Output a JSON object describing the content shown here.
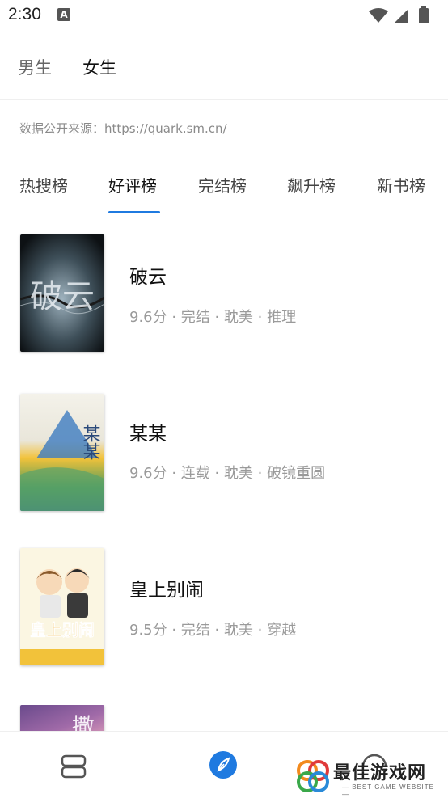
{
  "status_bar": {
    "time": "2:30",
    "notification_letter": "A"
  },
  "gender_tabs": [
    {
      "label": "男生",
      "active": false
    },
    {
      "label": "女生",
      "active": true
    }
  ],
  "source": {
    "text": "数据公开来源：https://quark.sm.cn/"
  },
  "ranking_tabs": [
    {
      "label": "热搜榜",
      "active": false
    },
    {
      "label": "好评榜",
      "active": true
    },
    {
      "label": "完结榜",
      "active": false
    },
    {
      "label": "飙升榜",
      "active": false
    },
    {
      "label": "新书榜",
      "active": false
    }
  ],
  "books": [
    {
      "title": "破云",
      "meta": "9.6分 · 完结 · 耽美 · 推理",
      "cover_text": "破云"
    },
    {
      "title": "某某",
      "meta": "9.6分 · 连载 · 耽美 · 破镜重圆",
      "cover_text": "某某"
    },
    {
      "title": "皇上别闹",
      "meta": "9.5分 · 完结 · 耽美 · 穿越",
      "cover_text": "皇上别闹"
    },
    {
      "title": "",
      "meta": "",
      "cover_text": "撒"
    }
  ],
  "bottom_nav": {
    "items": [
      {
        "name": "bookshelf",
        "icon": "bookshelf-icon"
      },
      {
        "name": "discover",
        "icon": "compass-icon",
        "active": true
      },
      {
        "name": "profile",
        "icon": "circle-icon"
      }
    ]
  },
  "watermark": {
    "title": "最佳游戏网",
    "subtitle": "— BEST GAME WEBSITE —"
  },
  "colors": {
    "accent": "#1f7ae0",
    "text": "#111111",
    "muted": "#9a9a9a"
  }
}
